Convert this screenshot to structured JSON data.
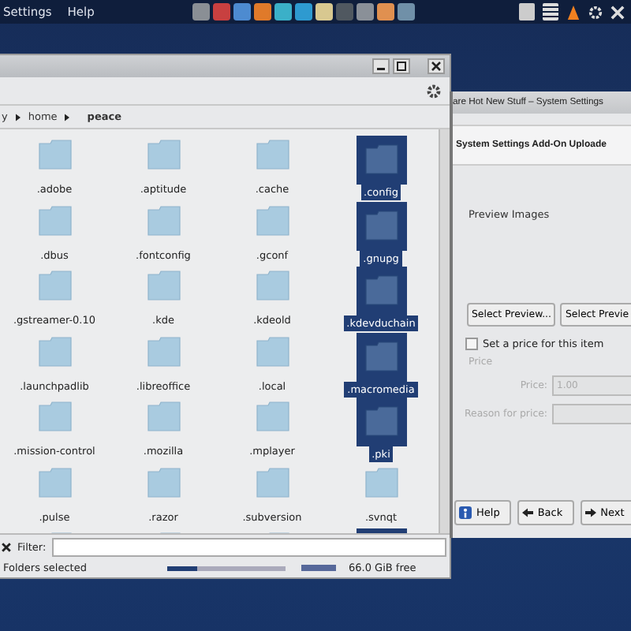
{
  "top_panel": {
    "menus": [
      "Settings",
      "Help"
    ]
  },
  "file_manager": {
    "breadcrumb": [
      "y",
      "home",
      "peace"
    ],
    "items": [
      {
        "label": ".adobe",
        "selected": false
      },
      {
        "label": ".aptitude",
        "selected": false
      },
      {
        "label": ".cache",
        "selected": false
      },
      {
        "label": ".config",
        "selected": true
      },
      {
        "label": ".dbus",
        "selected": false
      },
      {
        "label": ".fontconfig",
        "selected": false
      },
      {
        "label": ".gconf",
        "selected": false
      },
      {
        "label": ".gnupg",
        "selected": true
      },
      {
        "label": ".gstreamer-0.10",
        "selected": false
      },
      {
        "label": ".kde",
        "selected": false
      },
      {
        "label": ".kdeold",
        "selected": false
      },
      {
        "label": ".kdevduchain",
        "selected": true
      },
      {
        "label": ".launchpadlib",
        "selected": false
      },
      {
        "label": ".libreoffice",
        "selected": false
      },
      {
        "label": ".local",
        "selected": false
      },
      {
        "label": ".macromedia",
        "selected": true
      },
      {
        "label": ".mission-control",
        "selected": false
      },
      {
        "label": ".mozilla",
        "selected": false
      },
      {
        "label": ".mplayer",
        "selected": false
      },
      {
        "label": ".pki",
        "selected": true
      },
      {
        "label": ".pulse",
        "selected": false
      },
      {
        "label": ".razor",
        "selected": false
      },
      {
        "label": ".subversion",
        "selected": false
      },
      {
        "label": ".svnqt",
        "selected": false
      }
    ],
    "partial_row": [
      {
        "selected": false
      },
      {
        "selected": false
      },
      {
        "selected": false
      },
      {
        "selected": true
      }
    ],
    "filter": {
      "label": "Filter:"
    },
    "status_bar": {
      "text": "Folders selected",
      "zoom": {
        "level": 0.25
      },
      "disk": {
        "level": 1.0
      },
      "free": "66.0 GiB free"
    }
  },
  "dialog": {
    "title": "are Hot New Stuff – System Settings",
    "header": "System Settings Add-On Uploade",
    "preview_label": "Preview Images",
    "preview_buttons": [
      "Select Preview...",
      "Select Previe"
    ],
    "price_checkbox": {
      "label": "Set a price for this item",
      "checked": false
    },
    "price_group": {
      "title": "Price",
      "disabled": true,
      "price_label": "Price:",
      "price_value": "1.00",
      "reason_label": "Reason for price:"
    },
    "buttons": [
      {
        "kind": "help",
        "label": "Help"
      },
      {
        "kind": "back",
        "label": "Back"
      },
      {
        "kind": "next",
        "label": "Next"
      }
    ]
  }
}
